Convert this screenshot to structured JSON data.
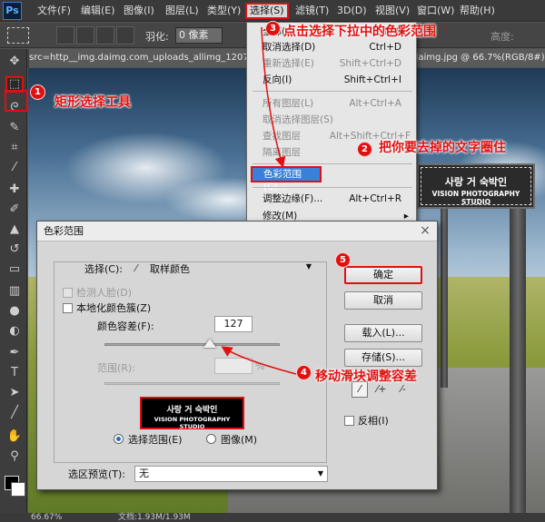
{
  "menubar": {
    "logo": "Ps",
    "items": [
      "文件(F)",
      "编辑(E)",
      "图像(I)",
      "图层(L)",
      "类型(Y)",
      "选择(S)",
      "滤镜(T)",
      "3D(D)",
      "视图(V)",
      "窗口(W)",
      "帮助(H)"
    ]
  },
  "optionsbar": {
    "feather_label": "羽化:",
    "feather_value": "0 像素",
    "height_label": "高度:"
  },
  "doc_tab": {
    "left": "src=http__img.daimg.com_uploads_allimg_1207...",
    "right": "daimg.jpg @ 66.7%(RGB/8#)"
  },
  "select_menu": {
    "items": [
      {
        "label": "全部(A)",
        "shortcut": "Ctrl+A",
        "disabled": false
      },
      {
        "label": "取消选择(D)",
        "shortcut": "Ctrl+D",
        "disabled": false
      },
      {
        "label": "重新选择(E)",
        "shortcut": "Shift+Ctrl+D",
        "disabled": true
      },
      {
        "label": "反向(I)",
        "shortcut": "Shift+Ctrl+I",
        "disabled": false
      },
      {
        "label": "所有图层(L)",
        "shortcut": "Alt+Ctrl+A",
        "disabled": true
      },
      {
        "label": "取消选择图层(S)",
        "shortcut": "",
        "disabled": true
      },
      {
        "label": "查找图层",
        "shortcut": "Alt+Shift+Ctrl+F",
        "disabled": true
      },
      {
        "label": "隔离图层",
        "shortcut": "",
        "disabled": true
      },
      {
        "label": "色彩范围(C)...",
        "shortcut": "",
        "disabled": false
      },
      {
        "label": "调整边缘(F)...",
        "shortcut": "Alt+Ctrl+R",
        "disabled": false
      },
      {
        "label": "修改(M)",
        "shortcut": "",
        "disabled": false
      }
    ]
  },
  "sign": {
    "korean": "사랑 거 숙박인",
    "english": "VISION PHOTOGRAPHY STUDIO"
  },
  "dialog": {
    "title": "色彩范围",
    "select_label": "选择(C):",
    "select_value": "取样颜色",
    "detect_faces": "检测人脸(D)",
    "localized": "本地化颜色簇(Z)",
    "fuzziness_label": "颜色容差(F):",
    "fuzziness_value": "127",
    "fuzziness_fraction": 0.6,
    "range_label": "范围(R):",
    "range_unit": "%",
    "radio_selection": "选择范围(E)",
    "radio_image": "图像(M)",
    "preview_label": "选区预览(T):",
    "preview_value": "无",
    "ok": "确定",
    "cancel": "取消",
    "load": "载入(L)...",
    "save": "存储(S)...",
    "invert": "反相(I)"
  },
  "annotations": {
    "n1": "1",
    "t1": "矩形选择工具",
    "n2": "2",
    "t2": "把你要去掉的文字圈住",
    "n3": "3",
    "t3": "点击选择下拉中的色彩范围",
    "n4": "4",
    "t4": "移动滑块调整容差",
    "n5": "5"
  },
  "statusbar": {
    "zoom": "66.67%",
    "doc": "文档:1.93M/1.93M"
  },
  "colors": {
    "annotation": "#e01010",
    "menu_highlight": "#3a7fd8"
  }
}
